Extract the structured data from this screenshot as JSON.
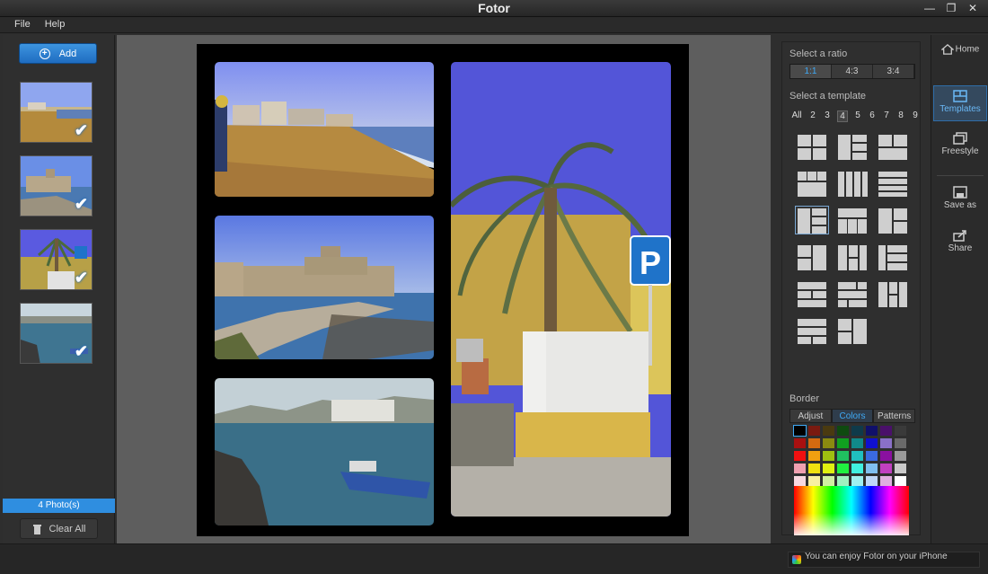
{
  "window": {
    "title": "Fotor",
    "minimize": "—",
    "restore": "❐",
    "close": "✕"
  },
  "menu": [
    "File",
    "Help"
  ],
  "left": {
    "add_label": "Add",
    "photo_count": "4 Photo(s)",
    "clear_label": "Clear All"
  },
  "right": {
    "ratio_title": "Select a ratio",
    "ratios": [
      "1:1",
      "4:3",
      "3:4"
    ],
    "template_title": "Select a template",
    "counts": [
      "All",
      "2",
      "3",
      "4",
      "5",
      "6",
      "7",
      "8",
      "9"
    ],
    "border_title": "Border",
    "border_tabs": [
      "Adjust",
      "Colors",
      "Patterns"
    ]
  },
  "nav": {
    "home": "Home",
    "templates": "Templates",
    "freestyle": "Freestyle",
    "saveas": "Save as",
    "share": "Share"
  },
  "bottom": {
    "notice": "You can enjoy Fotor on your iPhone"
  },
  "colors": {
    "accent": "#3fa9f5",
    "add_button": "#2a80d0",
    "photo_count_bg": "#2f8ee0"
  }
}
